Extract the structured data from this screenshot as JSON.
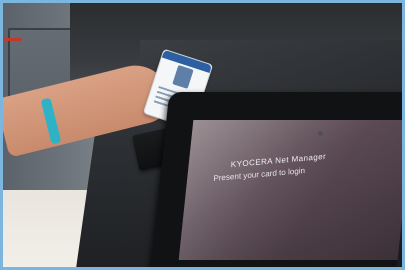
{
  "photo": {
    "screen": {
      "title": "KYOCERA Net Manager",
      "prompt": "Present your card to login"
    }
  }
}
